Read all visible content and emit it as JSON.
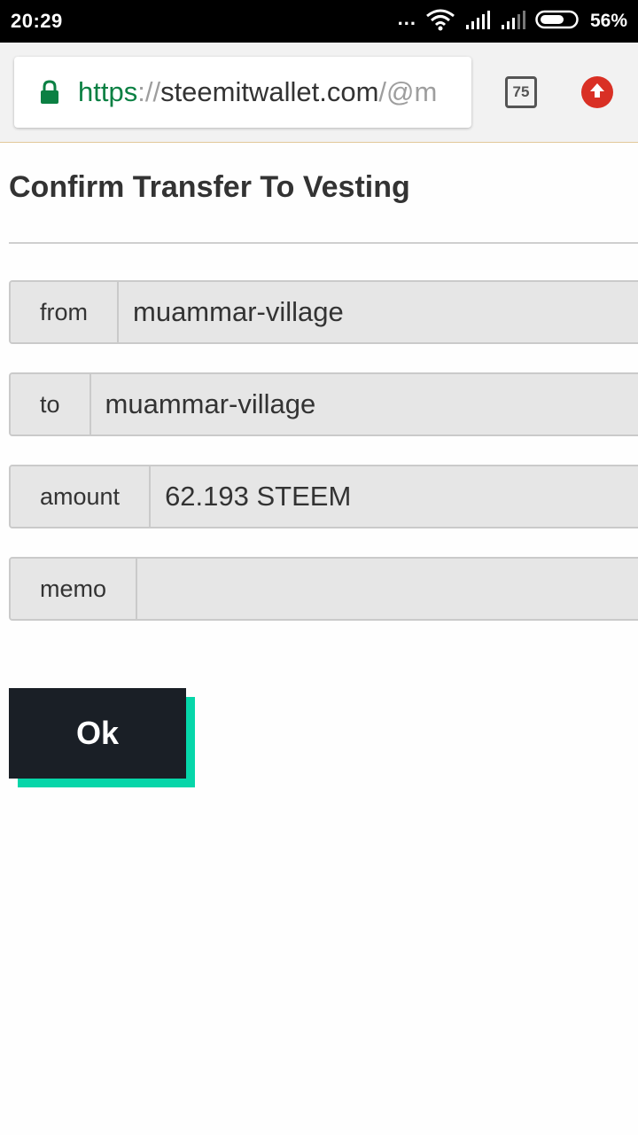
{
  "status_bar": {
    "time": "20:29",
    "dots": "...",
    "battery_percent": "56%",
    "icons": [
      "wifi-icon",
      "signal-icon",
      "signal-icon",
      "battery-icon"
    ]
  },
  "browser": {
    "url_scheme": "https",
    "url_separator": "://",
    "url_host": "steemitwallet.com",
    "url_path": "/@m",
    "tab_count": "75",
    "icons": [
      "lock-icon",
      "tabs-icon",
      "update-arrow-icon"
    ],
    "colors": {
      "secure": "#0b8043",
      "update": "#d93025"
    }
  },
  "page": {
    "title": "Confirm Transfer To Vesting",
    "fields": [
      {
        "label": "from",
        "value": "muammar-village"
      },
      {
        "label": "to",
        "value": "muammar-village"
      },
      {
        "label": "amount",
        "value": "62.193 STEEM"
      },
      {
        "label": "memo",
        "value": ""
      }
    ],
    "ok_label": "Ok",
    "colors": {
      "button": "#1a1f26",
      "button_accent": "#06d6a9"
    }
  }
}
